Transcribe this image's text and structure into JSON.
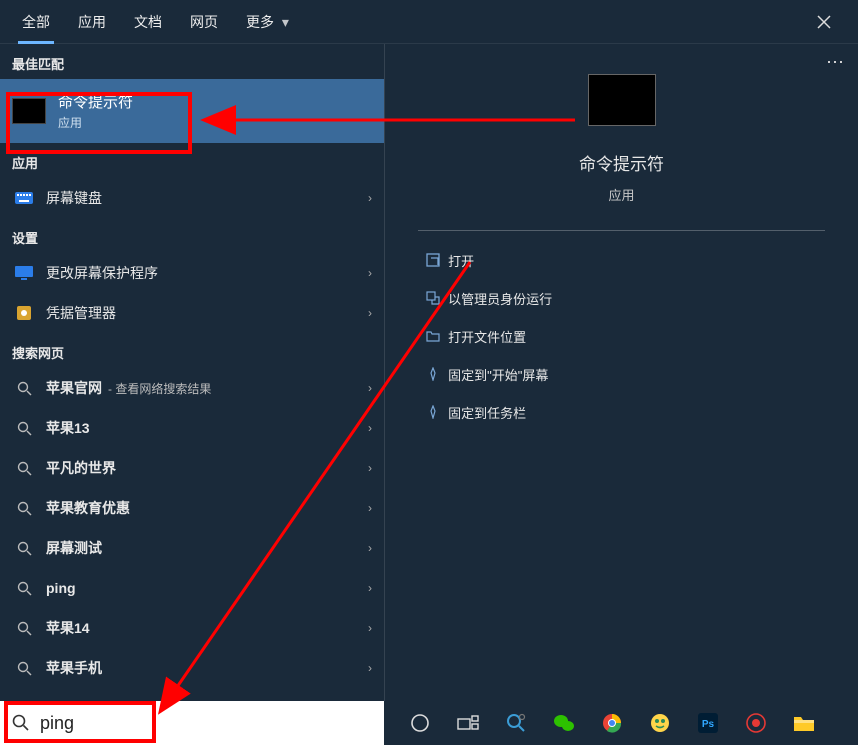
{
  "tabs": {
    "all": "全部",
    "apps": "应用",
    "documents": "文档",
    "web": "网页",
    "more": "更多"
  },
  "left": {
    "best_match_header": "最佳匹配",
    "best_match": {
      "title": "命令提示符",
      "subtitle": "应用"
    },
    "apps_header": "应用",
    "apps": [
      {
        "label": "屏幕键盘"
      }
    ],
    "settings_header": "设置",
    "settings": [
      {
        "label": "更改屏幕保护程序"
      },
      {
        "label": "凭据管理器"
      }
    ],
    "web_header": "搜索网页",
    "web": [
      {
        "label": "苹果官网",
        "sub": "- 查看网络搜索结果"
      },
      {
        "label": "苹果13"
      },
      {
        "label": "平凡的世界"
      },
      {
        "label": "苹果教育优惠"
      },
      {
        "label": "屏幕测试"
      },
      {
        "label": "ping"
      },
      {
        "label": "苹果14"
      },
      {
        "label": "苹果手机"
      }
    ]
  },
  "right": {
    "title": "命令提示符",
    "subtitle": "应用",
    "actions": [
      {
        "label": "打开"
      },
      {
        "label": "以管理员身份运行"
      },
      {
        "label": "打开文件位置"
      },
      {
        "label": "固定到\"开始\"屏幕"
      },
      {
        "label": "固定到任务栏"
      }
    ]
  },
  "search": {
    "value": "ping"
  }
}
